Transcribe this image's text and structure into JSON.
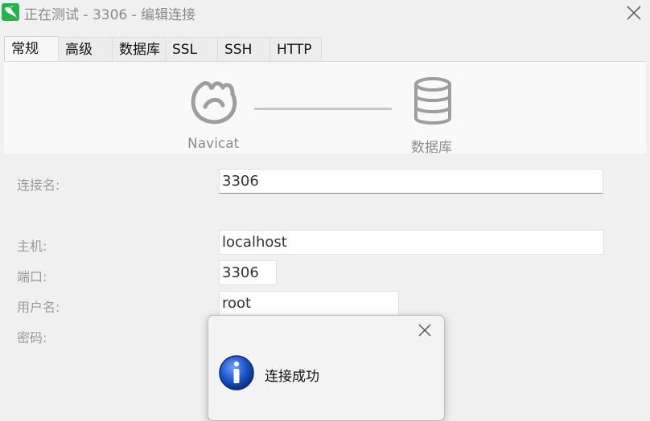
{
  "window": {
    "title": "正在测试 - 3306 - 编辑连接",
    "app_icon": "navicat-dolphin-icon",
    "close_icon": "close-icon"
  },
  "tabs": [
    {
      "label": "常规",
      "active": true
    },
    {
      "label": "高级",
      "active": false
    },
    {
      "label": "数据库",
      "active": false
    },
    {
      "label": "SSL",
      "active": false
    },
    {
      "label": "SSH",
      "active": false
    },
    {
      "label": "HTTP",
      "active": false
    }
  ],
  "diagram": {
    "left_label": "Navicat",
    "right_label": "数据库",
    "left_icon": "navicat-logo-icon",
    "right_icon": "database-icon"
  },
  "form": {
    "connection_name_label": "连接名:",
    "connection_name_value": "3306",
    "host_label": "主机:",
    "host_value": "localhost",
    "port_label": "端口:",
    "port_value": "3306",
    "username_label": "用户名:",
    "username_value": "root",
    "password_label": "密码:"
  },
  "dialog": {
    "message": "连接成功",
    "icon": "info-icon",
    "close_icon": "close-icon"
  },
  "colors": {
    "app_green": "#25b34a",
    "info_blue": "#1a55c8",
    "background": "#f0f0f0"
  }
}
